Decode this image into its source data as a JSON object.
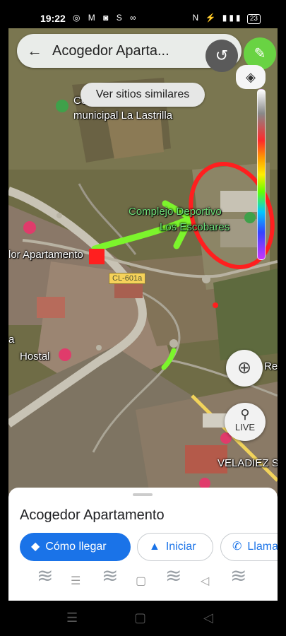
{
  "status_bar": {
    "time": "19:22",
    "left_icons": "◎ M ◙ S ∞",
    "right_icons": "N ⚡ ▮▮▮",
    "battery": "23"
  },
  "search": {
    "title": "Acogedor Aparta...",
    "back_icon": "←",
    "close_icon": "✕"
  },
  "similar_button": "Ver sitios similares",
  "tools": {
    "undo_icon": "↺",
    "pencil_icon": "✎",
    "layers_icon": "◈"
  },
  "map": {
    "labels": {
      "cemetery_1": "Cementerio",
      "cemetery_2": "municipal La Lastrilla",
      "complex_1": "Complejo Deportivo",
      "complex_2": "Los Escobares",
      "apartment": "lor Apartamento",
      "hostal": "Hostal",
      "road": "CL-601a",
      "left_edge": "a",
      "right_edge": "Re",
      "street": "VELADIEZ S"
    }
  },
  "controls": {
    "locate_icon": "⊕",
    "live_label": "LIVE",
    "live_icon": "⚲"
  },
  "sheet": {
    "title": "Acogedor Apartamento",
    "actions": {
      "directions": "Cómo llegar",
      "start": "Iniciar",
      "call": "Llama"
    }
  },
  "nav": {
    "menu": "☰",
    "home": "▢",
    "back": "◁"
  },
  "colors": {
    "accent": "#1a73e8",
    "annotation_green": "#7cf52c",
    "annotation_red": "#ff1f1f"
  }
}
